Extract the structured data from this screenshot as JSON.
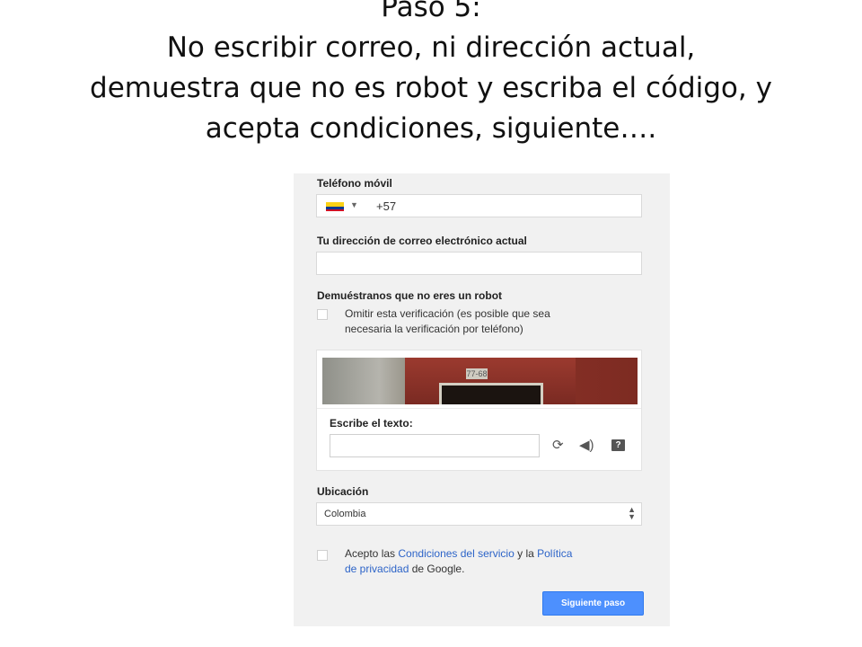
{
  "slide": {
    "title_lines": [
      "Paso 5:",
      "No escribir correo, ni dirección actual,",
      "demuestra que no es robot y escriba el código, y",
      "acepta condiciones, siguiente…."
    ]
  },
  "form": {
    "phone": {
      "label": "Teléfono móvil",
      "country_code": "+57",
      "flag": "colombia-flag"
    },
    "email": {
      "label": "Tu dirección de correo electrónico actual",
      "value": ""
    },
    "robot": {
      "label": "Demuéstranos que no eres un robot",
      "skip_text_line1": "Omitir esta verificación (es posible que sea",
      "skip_text_line2": "necesaria la verificación por teléfono)",
      "checked": false
    },
    "captcha": {
      "image_text": "77-68",
      "label": "Escribe el texto:",
      "value": "",
      "icons": [
        "refresh-icon",
        "audio-icon",
        "help-icon"
      ],
      "help_glyph": "?"
    },
    "location": {
      "label": "Ubicación",
      "selected": "Colombia"
    },
    "terms": {
      "prefix": "Acepto las ",
      "link1": "Condiciones del servicio",
      "middle": " y la ",
      "link2_part1": "Política",
      "link2_part2": "de privacidad",
      "suffix": " de Google.",
      "checked": false
    },
    "next_button": "Siguiente paso"
  },
  "colors": {
    "link": "#2d64c8",
    "primary_button": "#4d90fe",
    "panel_bg": "#f1f1f1"
  }
}
